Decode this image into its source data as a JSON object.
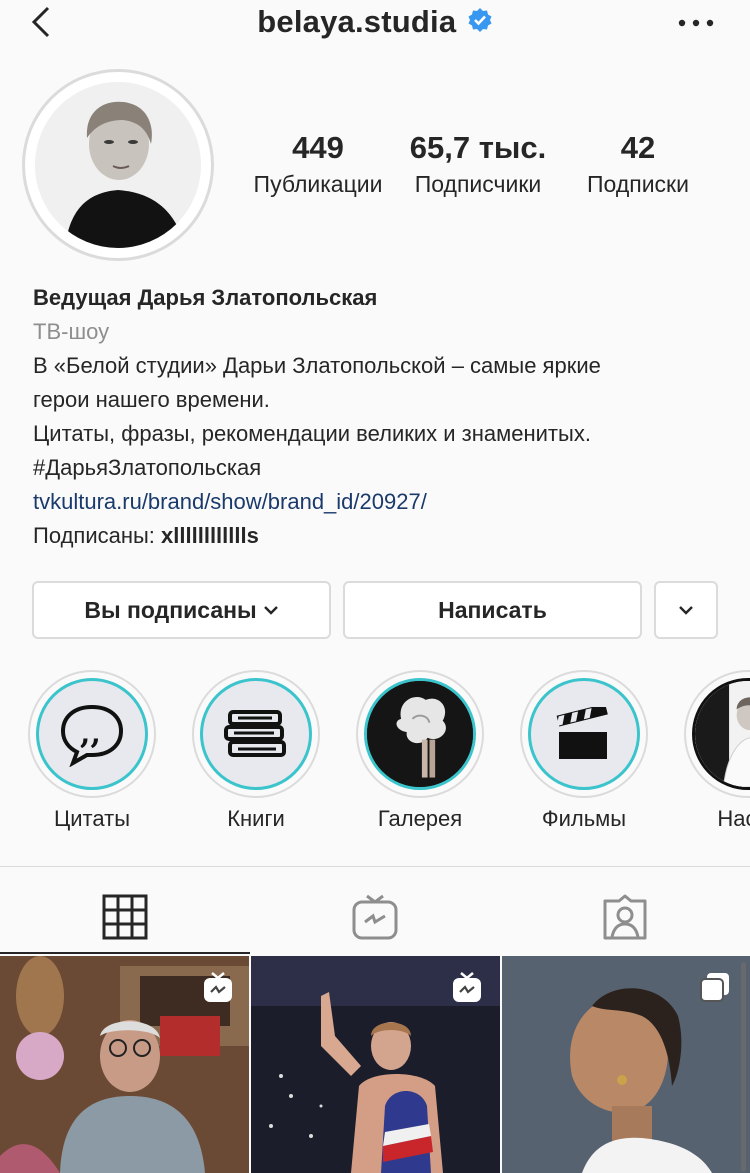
{
  "header": {
    "username": "belaya.studia",
    "back_icon": "chevron-left-icon",
    "verified_icon": "verified-badge-icon",
    "more_icon": "more-horizontal-icon"
  },
  "stats": {
    "posts": {
      "value": "449",
      "label": "Публикации"
    },
    "followers": {
      "value": "65,7 тыс.",
      "label": "Подписчики"
    },
    "following": {
      "value": "42",
      "label": "Подписки"
    }
  },
  "bio": {
    "name": "Ведущая Дарья Златопольская",
    "category": "ТВ-шоу",
    "line1": "В «Белой студии» Дарьи Златопольской – самые яркие",
    "line2": "герои нашего времени.",
    "line3": "Цитаты, фразы, рекомендации великих и знаменитых.",
    "hashtag": "#ДарьяЗлатопольская",
    "link": "tvkultura.ru/brand/show/brand_id/20927/",
    "followed_by_prefix": "Подписаны: ",
    "followed_by_user": "xlllllllllllls"
  },
  "actions": {
    "follow_label": "Вы подписаны",
    "message_label": "Написать"
  },
  "highlights": [
    {
      "label": "Цитаты",
      "icon": "quote-bubble-icon"
    },
    {
      "label": "Книги",
      "icon": "books-icon"
    },
    {
      "label": "Галерея",
      "icon": "gallery-image"
    },
    {
      "label": "Фильмы",
      "icon": "clapperboard-icon"
    },
    {
      "label": "Насто",
      "icon": "portrait-image"
    }
  ],
  "tabs": [
    {
      "name": "grid",
      "icon": "grid-icon"
    },
    {
      "name": "igtv",
      "icon": "igtv-icon"
    },
    {
      "name": "tagged",
      "icon": "tagged-person-icon"
    }
  ],
  "colors": {
    "accent_ring": "#3bc4cc",
    "link": "#1a3a6b",
    "verified": "#3897f0"
  }
}
